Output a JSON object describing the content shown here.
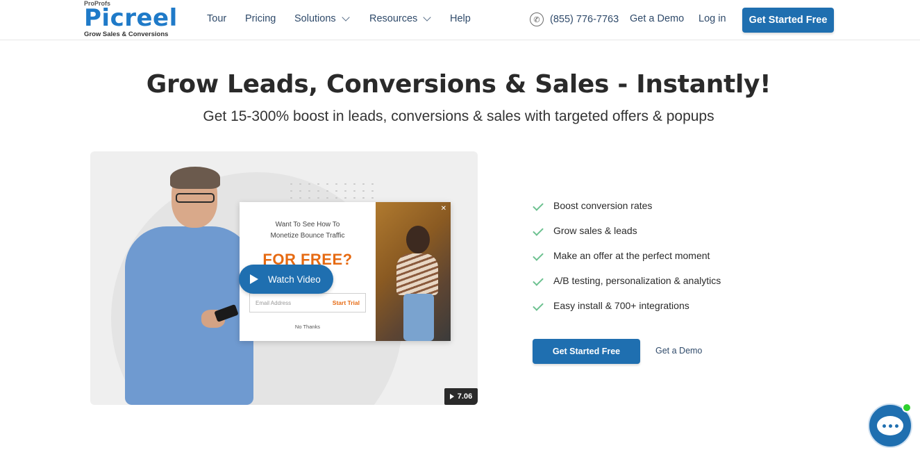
{
  "header": {
    "logo": {
      "top": "ProProfs",
      "main": "Picreel",
      "tagline": "Grow Sales & Conversions"
    },
    "nav": [
      {
        "label": "Tour"
      },
      {
        "label": "Pricing"
      },
      {
        "label": "Solutions"
      },
      {
        "label": "Resources"
      },
      {
        "label": "Help"
      }
    ],
    "phone": "(855) 776-7763",
    "demo": "Get a Demo",
    "login": "Log in",
    "cta": "Get Started Free"
  },
  "hero": {
    "title": "Grow Leads, Conversions & Sales - Instantly!",
    "subtitle": "Get 15-300% boost in leads, conversions & sales with targeted offers & popups"
  },
  "video": {
    "popup": {
      "line1": "Want To See How To",
      "line2": "Monetize Bounce Traffic",
      "headline": "FOR FREE?",
      "email_placeholder": "Email Address",
      "button": "Start Trial",
      "decline": "No Thanks"
    },
    "watch_label": "Watch Video",
    "duration": "7.06"
  },
  "features": [
    "Boost conversion rates",
    "Grow sales & leads",
    "Make an offer at the perfect moment",
    "A/B testing, personalization & analytics",
    "Easy install & 700+ integrations"
  ],
  "cta": {
    "primary": "Get Started Free",
    "secondary": "Get a Demo"
  },
  "colors": {
    "brand": "#1f6fb0",
    "accent_orange": "#e66a12",
    "check_green": "#6cc190",
    "online": "#2ed12e"
  }
}
